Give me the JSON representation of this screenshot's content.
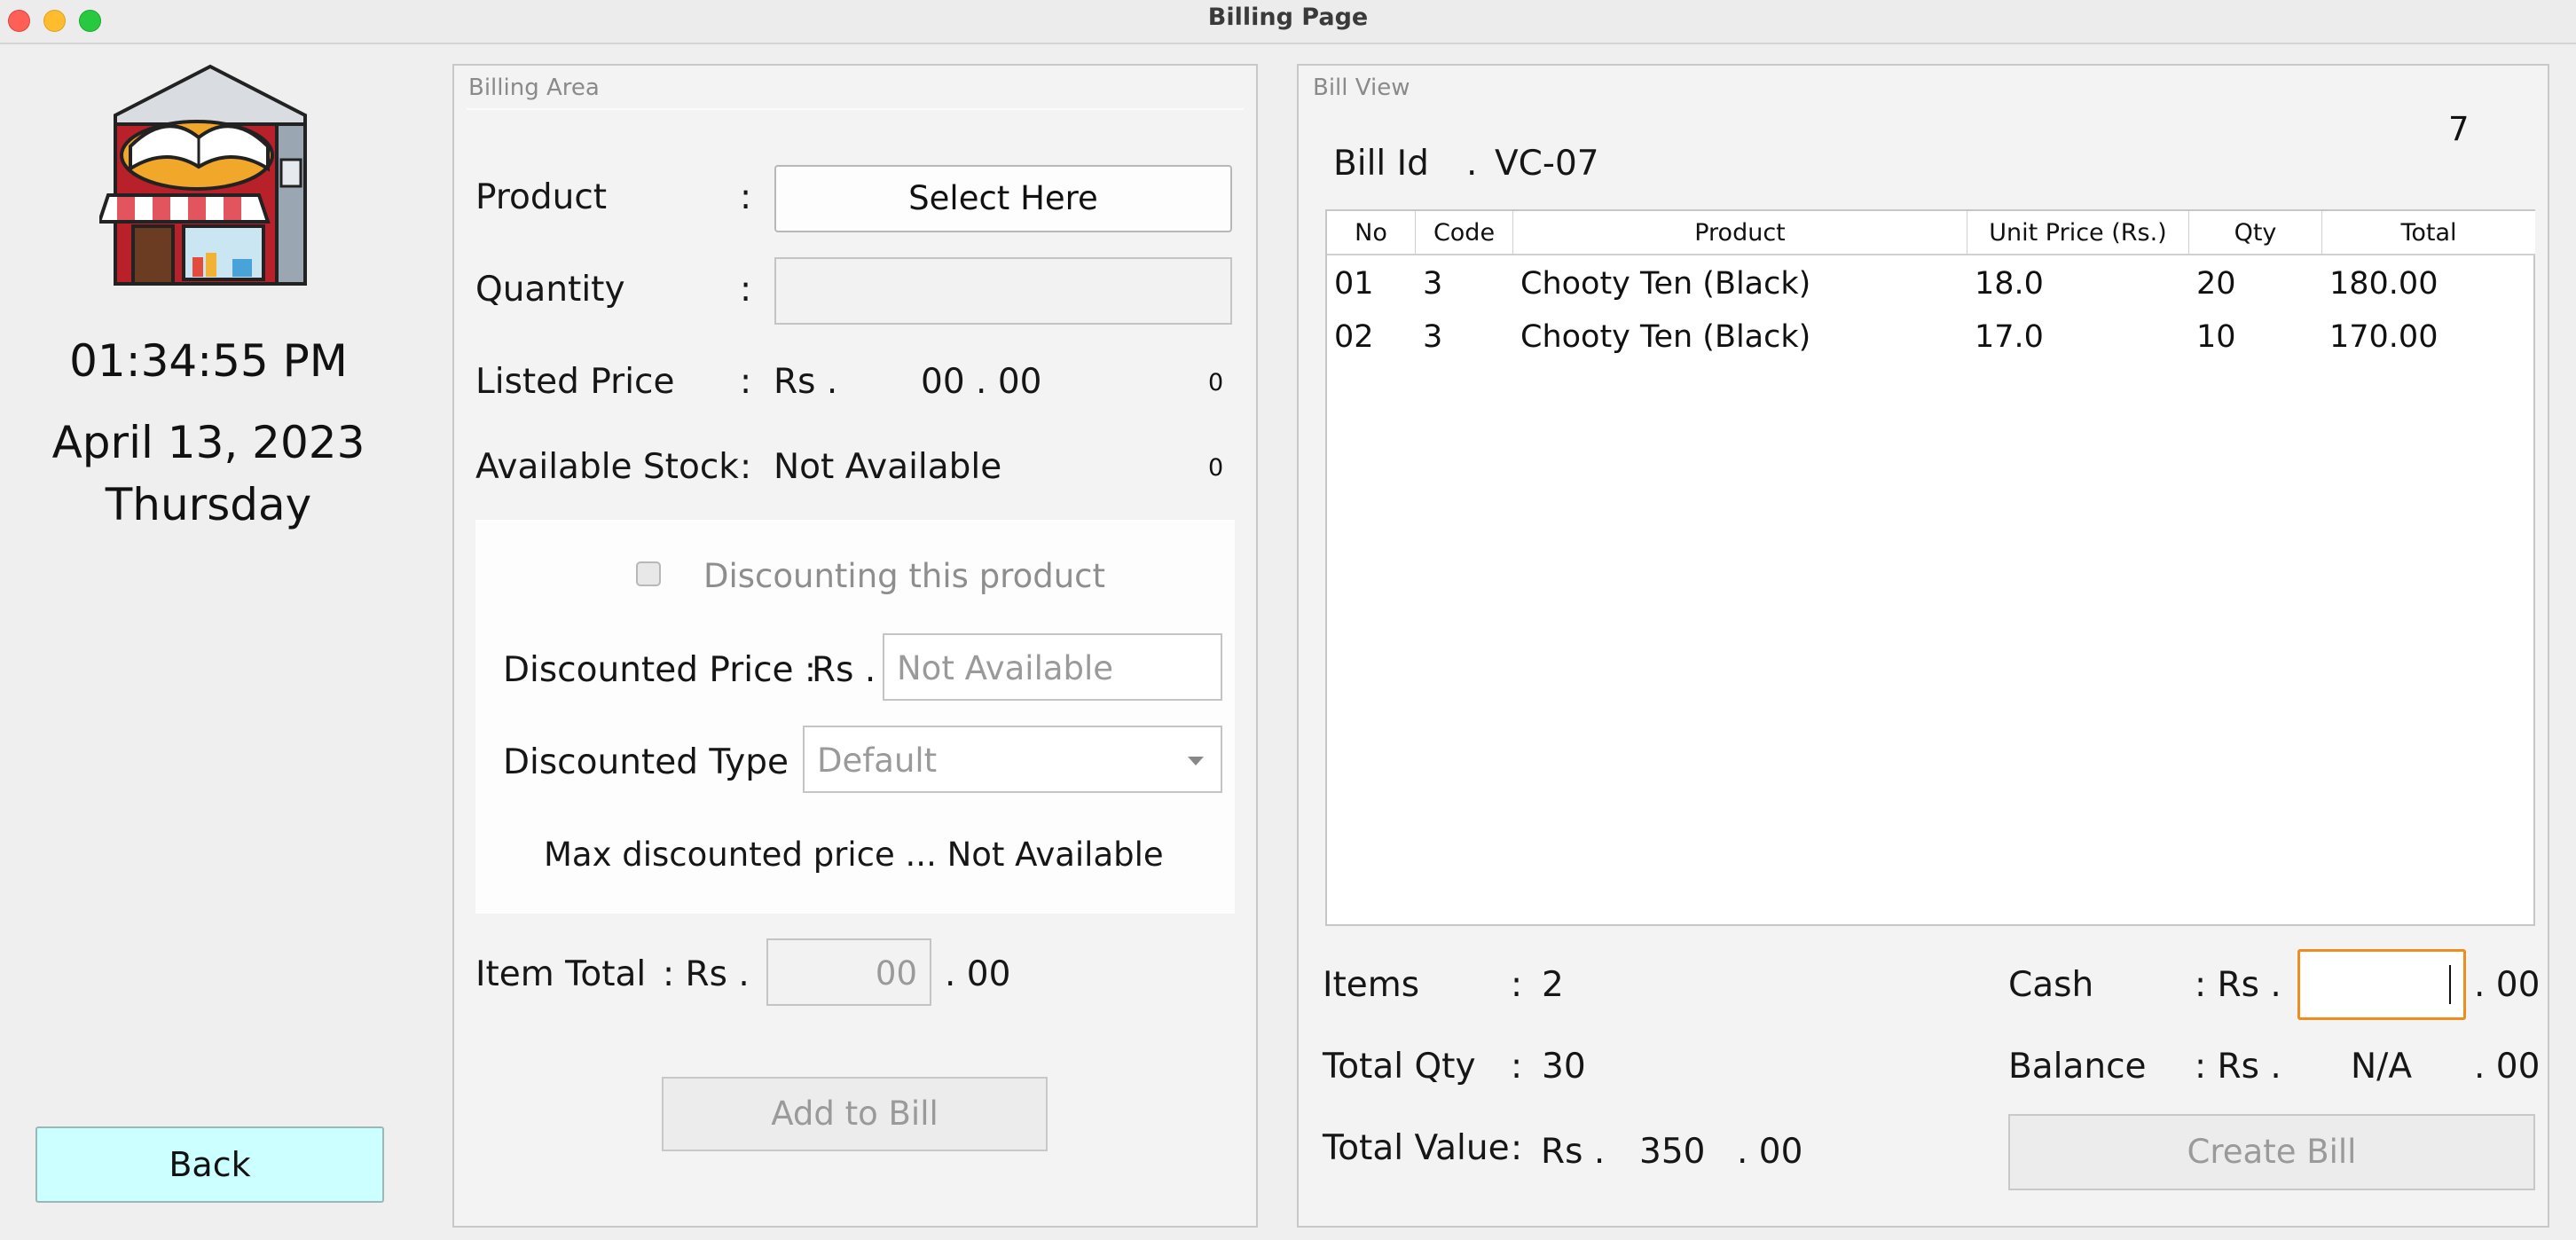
{
  "window": {
    "title": "Billing Page",
    "traffic_lights": {
      "close": "#fe5f57",
      "minimize": "#febc2e",
      "maximize": "#28c840"
    }
  },
  "sidebar": {
    "logo_icon": "bookstore-shop-icon",
    "time": "01:34:55 PM",
    "date": "April 13, 2023",
    "weekday": "Thursday",
    "back_label": "Back"
  },
  "billing_area": {
    "legend": "Billing Area",
    "product_label": "Product",
    "product_button": "Select Here",
    "quantity_label": "Quantity",
    "quantity_value": "",
    "listed_price_label": "Listed Price",
    "listed_price_currency": "Rs .",
    "listed_price_value": "00 . 00",
    "listed_price_count": "0",
    "available_stock_label": "Available Stock",
    "available_stock_value": "Not Available",
    "available_stock_count": "0",
    "colon": ":",
    "discount": {
      "checkbox_label": "Discounting this product",
      "checked": false,
      "discounted_price_label": "Discounted Price :",
      "discounted_price_currency": "Rs .",
      "discounted_price_placeholder": "Not Available",
      "discounted_type_label": "Discounted Type :",
      "discounted_type_value": "Default",
      "max_discount_text": "Max discounted price ... Not Available"
    },
    "item_total_label": "Item Total",
    "item_total_currency": ": Rs .",
    "item_total_value": "00",
    "item_total_decimals": ". 00",
    "add_to_bill_label": "Add to Bill"
  },
  "bill_view": {
    "legend": "Bill View",
    "counter": "7",
    "bill_id_label": "Bill Id",
    "bill_id_sep": ".",
    "bill_id_value": "VC-07",
    "table": {
      "columns": [
        "No",
        "Code",
        "Product",
        "Unit Price (Rs.)",
        "Qty",
        "Total"
      ],
      "rows": [
        [
          "01",
          "3",
          "Chooty Ten (Black)",
          "18.0",
          "20",
          "180.00"
        ],
        [
          "02",
          "3",
          "Chooty Ten (Black)",
          "17.0",
          "10",
          "170.00"
        ]
      ]
    },
    "items_label": "Items",
    "items_value": "2",
    "total_qty_label": "Total Qty",
    "total_qty_value": "30",
    "total_value_label": "Total Value",
    "total_value_currency": "Rs .",
    "total_value_value": "350",
    "total_value_decimals": ". 00",
    "colon": ":",
    "cash_label": "Cash",
    "cash_currency": ": Rs .",
    "cash_value": "",
    "cash_decimals": ". 00",
    "balance_label": "Balance",
    "balance_currency": ": Rs .",
    "balance_value": "N/A",
    "balance_decimals": ". 00",
    "create_bill_label": "Create Bill"
  }
}
